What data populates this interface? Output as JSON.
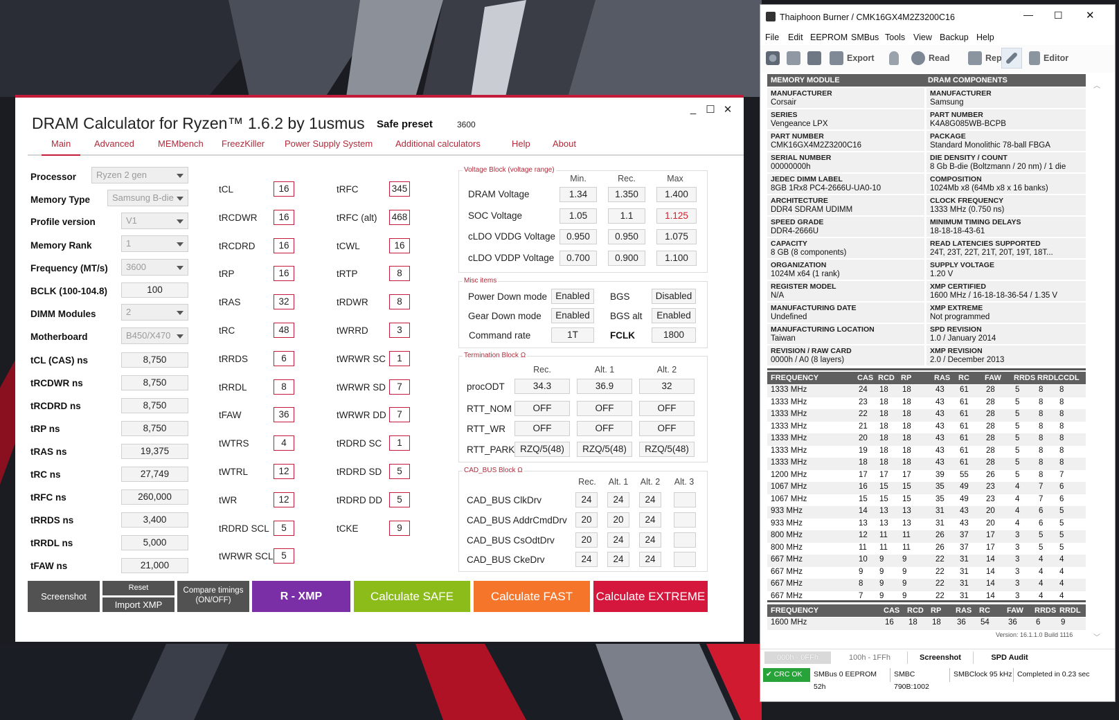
{
  "dram": {
    "title": "DRAM Calculator for Ryzen™ 1.6.2 by 1usmus",
    "window_controls": {
      "minimize": "_",
      "maximize": "☐",
      "close": "✕"
    },
    "preset_label": "Safe preset",
    "preset_value": "3600",
    "tabs": [
      "Main",
      "Advanced",
      "MEMbench",
      "FreezKiller",
      "Power Supply System",
      "Additional calculators",
      "Help",
      "About"
    ],
    "left": {
      "processor": {
        "label": "Processor",
        "value": "Ryzen 2 gen"
      },
      "memory_type": {
        "label": "Memory Type",
        "value": "Samsung B-die"
      },
      "profile_version": {
        "label": "Profile version",
        "value": "V1"
      },
      "memory_rank": {
        "label": "Memory Rank",
        "value": "1"
      },
      "frequency": {
        "label": "Frequency (MT/s)",
        "value": "3600"
      },
      "bclk": {
        "label": "BCLK (100-104.8)",
        "value": "100"
      },
      "dimm_modules": {
        "label": "DIMM Modules",
        "value": "2"
      },
      "motherboard": {
        "label": "Motherboard",
        "value": "B450/X470"
      },
      "ns": [
        {
          "label": "tCL (CAS) ns",
          "value": "8,750"
        },
        {
          "label": "tRCDWR ns",
          "value": "8,750"
        },
        {
          "label": "tRCDRD ns",
          "value": "8,750"
        },
        {
          "label": "tRP ns",
          "value": "8,750"
        },
        {
          "label": "tRAS ns",
          "value": "19,375"
        },
        {
          "label": "tRC ns",
          "value": "27,749"
        },
        {
          "label": "tRFC ns",
          "value": "260,000"
        },
        {
          "label": "tRRDS ns",
          "value": "3,400"
        },
        {
          "label": "tRRDL ns",
          "value": "5,000"
        },
        {
          "label": "tFAW ns",
          "value": "21,000"
        }
      ]
    },
    "timings_col1": [
      {
        "label": "tCL",
        "value": "16"
      },
      {
        "label": "tRCDWR",
        "value": "16"
      },
      {
        "label": "tRCDRD",
        "value": "16"
      },
      {
        "label": "tRP",
        "value": "16"
      },
      {
        "label": "tRAS",
        "value": "32"
      },
      {
        "label": "tRC",
        "value": "48"
      },
      {
        "label": "tRRDS",
        "value": "6"
      },
      {
        "label": "tRRDL",
        "value": "8"
      },
      {
        "label": "tFAW",
        "value": "36"
      },
      {
        "label": "tWTRS",
        "value": "4"
      },
      {
        "label": "tWTRL",
        "value": "12"
      },
      {
        "label": "tWR",
        "value": "12"
      },
      {
        "label": "tRDRD SCL",
        "value": "5"
      },
      {
        "label": "tWRWR SCL",
        "value": "5"
      }
    ],
    "timings_col2": [
      {
        "label": "tRFC",
        "value": "345"
      },
      {
        "label": "tRFC (alt)",
        "value": "468"
      },
      {
        "label": "tCWL",
        "value": "16"
      },
      {
        "label": "tRTP",
        "value": "8"
      },
      {
        "label": "tRDWR",
        "value": "8"
      },
      {
        "label": "tWRRD",
        "value": "3"
      },
      {
        "label": "tWRWR SC",
        "value": "1"
      },
      {
        "label": "tWRWR SD",
        "value": "7"
      },
      {
        "label": "tWRWR DD",
        "value": "7"
      },
      {
        "label": "tRDRD SC",
        "value": "1"
      },
      {
        "label": "tRDRD SD",
        "value": "5"
      },
      {
        "label": "tRDRD DD",
        "value": "5"
      },
      {
        "label": "tCKE",
        "value": "9"
      }
    ],
    "voltage": {
      "title": "Voltage Block (voltage range)",
      "headers": [
        "Min.",
        "Rec.",
        "Max"
      ],
      "rows": [
        {
          "label": "DRAM Voltage",
          "min": "1.34",
          "rec": "1.350",
          "max": "1.400"
        },
        {
          "label": "SOC Voltage",
          "min": "1.05",
          "rec": "1.1",
          "max": "1.125"
        },
        {
          "label": "cLDO VDDG Voltage",
          "min": "0.950",
          "rec": "0.950",
          "max": "1.075"
        },
        {
          "label": "cLDO VDDP Voltage",
          "min": "0.700",
          "rec": "0.900",
          "max": "1.100"
        }
      ],
      "warning_color": "#d0202c"
    },
    "misc": {
      "title": "Misc items",
      "power_down": {
        "label": "Power Down mode",
        "value": "Enabled"
      },
      "gear_down": {
        "label": "Gear Down mode",
        "value": "Enabled"
      },
      "command_rate": {
        "label": "Command rate",
        "value": "1T"
      },
      "bgs": {
        "label": "BGS",
        "value": "Disabled"
      },
      "bgs_alt": {
        "label": "BGS alt",
        "value": "Enabled"
      },
      "fclk": {
        "label": "FCLK",
        "value": "1800"
      }
    },
    "termination": {
      "title": "Termination Block Ω",
      "headers": [
        "Rec.",
        "Alt. 1",
        "Alt. 2"
      ],
      "rows": [
        {
          "label": "procODT",
          "v": [
            "34.3",
            "36.9",
            "32"
          ]
        },
        {
          "label": "RTT_NOM",
          "v": [
            "OFF",
            "OFF",
            "OFF"
          ]
        },
        {
          "label": "RTT_WR",
          "v": [
            "OFF",
            "OFF",
            "OFF"
          ]
        },
        {
          "label": "RTT_PARK",
          "v": [
            "RZQ/5(48)",
            "RZQ/5(48)",
            "RZQ/5(48)"
          ]
        }
      ]
    },
    "cadbus": {
      "title": "CAD_BUS Block Ω",
      "headers": [
        "Rec.",
        "Alt. 1",
        "Alt. 2",
        "Alt. 3"
      ],
      "rows": [
        {
          "label": "CAD_BUS ClkDrv",
          "v": [
            "24",
            "24",
            "24",
            ""
          ]
        },
        {
          "label": "CAD_BUS AddrCmdDrv",
          "v": [
            "20",
            "20",
            "24",
            ""
          ]
        },
        {
          "label": "CAD_BUS CsOdtDrv",
          "v": [
            "20",
            "24",
            "24",
            ""
          ]
        },
        {
          "label": "CAD_BUS CkeDrv",
          "v": [
            "24",
            "24",
            "24",
            ""
          ]
        }
      ]
    },
    "buttons": {
      "screenshot": "Screenshot",
      "reset": "Reset",
      "import_xmp": "Import XMP",
      "compare": "Compare timings\n(ON/OFF)",
      "rxmp": "R - XMP",
      "safe": "Calculate SAFE",
      "fast": "Calculate FAST",
      "extreme": "Calculate EXTREME"
    },
    "colors": {
      "accent": "#c31c3a",
      "rxmp": "#7b2fa7",
      "safe": "#8cbc1a",
      "fast": "#f5762b",
      "extreme": "#d6173d",
      "gray_btn": "#525252"
    }
  },
  "thai": {
    "title": "Thaiphoon Burner / CMK16GX4M2Z3200C16",
    "menu": [
      "File",
      "Edit",
      "EEPROM",
      "SMBus",
      "Tools",
      "View",
      "Backup",
      "Help"
    ],
    "toolbar": [
      {
        "icon": "settings-icon",
        "label": ""
      },
      {
        "icon": "open-icon",
        "label": ""
      },
      {
        "icon": "save-icon",
        "label": ""
      },
      {
        "icon": "export-icon",
        "label": "Export"
      },
      {
        "icon": "lock-icon",
        "label": ""
      },
      {
        "icon": "read-icon",
        "label": "Read"
      },
      {
        "icon": "report-icon",
        "label": "Report"
      },
      {
        "icon": "wrench-icon",
        "label": ""
      },
      {
        "icon": "editor-icon",
        "label": "Editor"
      }
    ],
    "module_header": "MEMORY MODULE",
    "components_header": "DRAM COMPONENTS",
    "module": [
      {
        "k": "MANUFACTURER",
        "v": "Corsair"
      },
      {
        "k": "SERIES",
        "v": "Vengeance LPX"
      },
      {
        "k": "PART NUMBER",
        "v": "CMK16GX4M2Z3200C16"
      },
      {
        "k": "SERIAL NUMBER",
        "v": "00000000h"
      },
      {
        "k": "JEDEC DIMM LABEL",
        "v": "8GB 1Rx8 PC4-2666U-UA0-10"
      },
      {
        "k": "ARCHITECTURE",
        "v": "DDR4 SDRAM UDIMM"
      },
      {
        "k": "SPEED GRADE",
        "v": "DDR4-2666U"
      },
      {
        "k": "CAPACITY",
        "v": "8 GB (8 components)"
      },
      {
        "k": "ORGANIZATION",
        "v": "1024M x64 (1 rank)"
      },
      {
        "k": "REGISTER MODEL",
        "v": "N/A"
      },
      {
        "k": "MANUFACTURING DATE",
        "v": "Undefined"
      },
      {
        "k": "MANUFACTURING LOCATION",
        "v": "Taiwan"
      },
      {
        "k": "REVISION / RAW CARD",
        "v": "0000h / A0 (8 layers)"
      }
    ],
    "components": [
      {
        "k": "MANUFACTURER",
        "v": "Samsung"
      },
      {
        "k": "PART NUMBER",
        "v": "K4A8G085WB-BCPB"
      },
      {
        "k": "PACKAGE",
        "v": "Standard Monolithic 78-ball FBGA"
      },
      {
        "k": "DIE DENSITY / COUNT",
        "v": "8 Gb B-die (Boltzmann / 20 nm) / 1 die"
      },
      {
        "k": "COMPOSITION",
        "v": "1024Mb x8 (64Mb x8 x 16 banks)"
      },
      {
        "k": "CLOCK FREQUENCY",
        "v": "1333 MHz (0.750 ns)"
      },
      {
        "k": "MINIMUM TIMING DELAYS",
        "v": "18-18-18-43-61"
      },
      {
        "k": "READ LATENCIES SUPPORTED",
        "v": "24T, 23T, 22T, 21T, 20T, 19T, 18T..."
      },
      {
        "k": "SUPPLY VOLTAGE",
        "v": "1.20 V"
      },
      {
        "k": "XMP CERTIFIED",
        "v": "1600 MHz / 16-18-18-36-54 / 1.35 V"
      },
      {
        "k": "XMP EXTREME",
        "v": "Not programmed"
      },
      {
        "k": "SPD REVISION",
        "v": "1.0 / January 2014"
      },
      {
        "k": "XMP REVISION",
        "v": "2.0 / December 2013"
      }
    ],
    "freq_headers": [
      "FREQUENCY",
      "CAS",
      "RCD",
      "RP",
      "RAS",
      "RC",
      "FAW",
      "RRDS",
      "RRDL",
      "CCDL"
    ],
    "freq_rows": [
      [
        "1333 MHz",
        "24",
        "18",
        "18",
        "43",
        "61",
        "28",
        "5",
        "8",
        "8"
      ],
      [
        "1333 MHz",
        "23",
        "18",
        "18",
        "43",
        "61",
        "28",
        "5",
        "8",
        "8"
      ],
      [
        "1333 MHz",
        "22",
        "18",
        "18",
        "43",
        "61",
        "28",
        "5",
        "8",
        "8"
      ],
      [
        "1333 MHz",
        "21",
        "18",
        "18",
        "43",
        "61",
        "28",
        "5",
        "8",
        "8"
      ],
      [
        "1333 MHz",
        "20",
        "18",
        "18",
        "43",
        "61",
        "28",
        "5",
        "8",
        "8"
      ],
      [
        "1333 MHz",
        "19",
        "18",
        "18",
        "43",
        "61",
        "28",
        "5",
        "8",
        "8"
      ],
      [
        "1333 MHz",
        "18",
        "18",
        "18",
        "43",
        "61",
        "28",
        "5",
        "8",
        "8"
      ],
      [
        "1200 MHz",
        "17",
        "17",
        "17",
        "39",
        "55",
        "26",
        "5",
        "8",
        "7"
      ],
      [
        "1067 MHz",
        "16",
        "15",
        "15",
        "35",
        "49",
        "23",
        "4",
        "7",
        "6"
      ],
      [
        "1067 MHz",
        "15",
        "15",
        "15",
        "35",
        "49",
        "23",
        "4",
        "7",
        "6"
      ],
      [
        "933 MHz",
        "14",
        "13",
        "13",
        "31",
        "43",
        "20",
        "4",
        "6",
        "5"
      ],
      [
        "933 MHz",
        "13",
        "13",
        "13",
        "31",
        "43",
        "20",
        "4",
        "6",
        "5"
      ],
      [
        "800 MHz",
        "12",
        "11",
        "11",
        "26",
        "37",
        "17",
        "3",
        "5",
        "5"
      ],
      [
        "800 MHz",
        "11",
        "11",
        "11",
        "26",
        "37",
        "17",
        "3",
        "5",
        "5"
      ],
      [
        "667 MHz",
        "10",
        "9",
        "9",
        "22",
        "31",
        "14",
        "3",
        "4",
        "4"
      ],
      [
        "667 MHz",
        "9",
        "9",
        "9",
        "22",
        "31",
        "14",
        "3",
        "4",
        "4"
      ],
      [
        "667 MHz",
        "8",
        "9",
        "9",
        "22",
        "31",
        "14",
        "3",
        "4",
        "4"
      ],
      [
        "667 MHz",
        "7",
        "9",
        "9",
        "22",
        "31",
        "14",
        "3",
        "4",
        "4"
      ]
    ],
    "xmp_headers": [
      "FREQUENCY",
      "CAS",
      "RCD",
      "RP",
      "RAS",
      "RC",
      "FAW",
      "RRDS",
      "RRDL"
    ],
    "xmp_row": [
      "1600 MHz",
      "16",
      "18",
      "18",
      "36",
      "54",
      "36",
      "6",
      "9"
    ],
    "version": "Version: 16.1.1.0 Build 1116",
    "bottom_tabs": [
      "000h - 0FFh",
      "100h - 1FFh",
      "Screenshot",
      "SPD Audit"
    ],
    "status": [
      "CRC OK",
      "SMBus 0 EEPROM 52h",
      "SMBC 790B:1002",
      "SMBClock 95 kHz",
      "Completed in 0.23 sec"
    ]
  }
}
